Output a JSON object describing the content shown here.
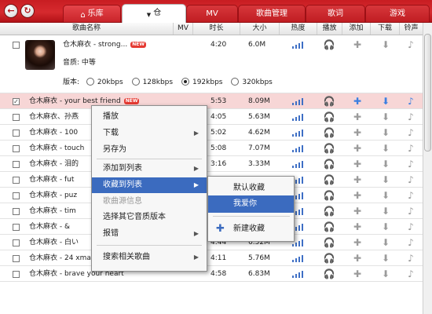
{
  "nav": {
    "back_icon": "back-arrow-icon",
    "refresh_icon": "refresh-icon"
  },
  "tabs": [
    {
      "label": "乐库",
      "icon": "home-icon"
    },
    {
      "label": "仓",
      "icon": "chevron-down-icon"
    },
    {
      "label": "MV"
    },
    {
      "label": "歌曲管理"
    },
    {
      "label": "歌词"
    },
    {
      "label": "游戏"
    }
  ],
  "table": {
    "headers": [
      "歌曲名称",
      "MV",
      "时长",
      "大小",
      "热度",
      "播放",
      "添加",
      "下载",
      "铃声"
    ],
    "expanded": {
      "title": "仓木麻衣 - strong...",
      "new_badge": "NEW",
      "quality_label": "音质:",
      "quality_value": "中等",
      "version_label": "版本:",
      "versions": [
        "20kbps",
        "128kbps",
        "192kbps",
        "320kbps"
      ],
      "selected_version": "192kbps",
      "duration": "4:20",
      "size": "6.0M",
      "heat_bars": 4
    },
    "rows": [
      {
        "title": "仓木麻衣 - your best friend",
        "new": true,
        "checked": true,
        "selected": true,
        "duration": "5:53",
        "size": "8.09M",
        "heat": 4,
        "mv": false
      },
      {
        "title": "仓木麻衣、孙燕",
        "new": false,
        "checked": false,
        "selected": false,
        "duration": "4:05",
        "size": "5.63M",
        "heat": 4,
        "mv": true
      },
      {
        "title": "仓木麻衣 - 100",
        "new": false,
        "checked": false,
        "selected": false,
        "duration": "5:02",
        "size": "4.62M",
        "heat": 4,
        "mv": false
      },
      {
        "title": "仓木麻衣 - touch",
        "new": false,
        "checked": false,
        "selected": false,
        "duration": "5:08",
        "size": "7.07M",
        "heat": 4,
        "mv": false
      },
      {
        "title": "仓木麻衣 - 泪的",
        "new": false,
        "checked": false,
        "selected": false,
        "duration": "3:16",
        "size": "3.33M",
        "heat": 4,
        "mv": false
      },
      {
        "title": "仓木麻衣 - fut",
        "new": false,
        "checked": false,
        "selected": false,
        "duration": "",
        "size": "",
        "heat": 4,
        "mv": false
      },
      {
        "title": "仓木麻衣 - puz",
        "new": false,
        "checked": false,
        "selected": false,
        "duration": "",
        "size": "",
        "heat": 4,
        "mv": false
      },
      {
        "title": "仓木麻衣 - tim",
        "new": false,
        "checked": false,
        "selected": false,
        "duration": "",
        "size": "",
        "heat": 4,
        "mv": false
      },
      {
        "title": "仓木麻衣 - &",
        "new": false,
        "checked": false,
        "selected": false,
        "duration": "4:36",
        "size": "6.31M",
        "heat": 4,
        "mv": false
      },
      {
        "title": "仓木麻衣 - 白い",
        "new": false,
        "checked": false,
        "selected": false,
        "duration": "4:44",
        "size": "6.52M",
        "heat": 4,
        "mv": false
      },
      {
        "title": "仓木麻衣 - 24 xmas time",
        "new": false,
        "checked": false,
        "selected": false,
        "duration": "4:11",
        "size": "5.76M",
        "heat": 4,
        "mv": true
      },
      {
        "title": "仓木麻衣 - brave your heart",
        "new": false,
        "checked": false,
        "selected": false,
        "duration": "4:58",
        "size": "6.83M",
        "heat": 4,
        "mv": false
      }
    ]
  },
  "context_menu": {
    "items": [
      {
        "label": "播放",
        "submenu": false
      },
      {
        "label": "下载",
        "submenu": true
      },
      {
        "label": "另存为",
        "submenu": false
      },
      {
        "label": "添加到列表",
        "submenu": true
      },
      {
        "label": "收藏到列表",
        "submenu": true,
        "highlighted": true
      },
      {
        "label": "歌曲源信息",
        "submenu": false,
        "disabled": true
      },
      {
        "label": "选择其它音质版本",
        "submenu": false
      },
      {
        "label": "报错",
        "submenu": true
      },
      {
        "label": "搜索相关歌曲",
        "submenu": true
      }
    ]
  },
  "submenu": {
    "items": [
      {
        "label": "默认收藏"
      },
      {
        "label": "我爱你",
        "highlighted": true
      },
      {
        "label": "新建收藏",
        "icon": "plus-icon"
      }
    ]
  },
  "colors": {
    "brand_red": "#c81d22",
    "highlight_blue": "#3b6bbf",
    "heat_blue": "#3e6fc5",
    "new_badge": "#e53a32"
  }
}
